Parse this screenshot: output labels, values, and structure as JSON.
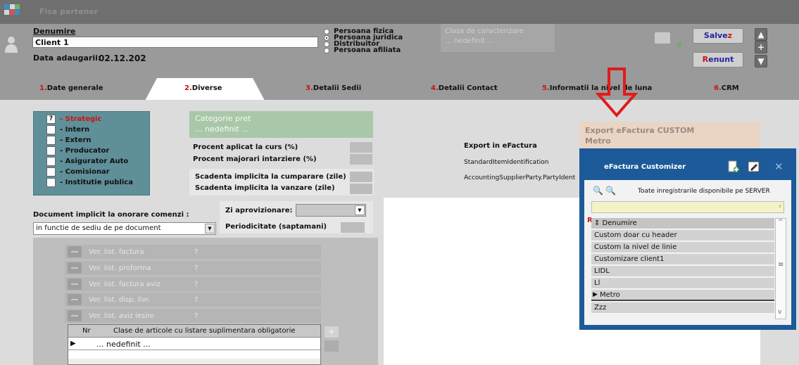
{
  "window": {
    "title": "Fisa partener",
    "icon": "app-grid-icon"
  },
  "header": {
    "denumire_label": "Denumire",
    "client_name": "Client 1",
    "data_adaugarii_label": "Data adaugarii:",
    "data_adaugarii_value": "02.12.202",
    "radio_options": [
      {
        "label": "Persoana fizica",
        "selected": false
      },
      {
        "label": "Persoana juridica",
        "selected": true
      },
      {
        "label": "Distribuitor",
        "selected": false
      },
      {
        "label": "Persoana afiliata",
        "selected": false
      }
    ],
    "clasa_label": "Clasa de caracterizare",
    "clasa_value": "... nedefinit ...",
    "folder_count": "0",
    "salvez_main": "Salve",
    "salvez_hotkey": "z",
    "renunt_hotkey": "R",
    "renunt_rest": "enunt"
  },
  "tabs": [
    {
      "num": "1.",
      "label": "Date generale"
    },
    {
      "num": "2.",
      "label": "Diverse"
    },
    {
      "num": "3.",
      "label": "Detalii Sedii"
    },
    {
      "num": "4.",
      "label": "Detalii Contact"
    },
    {
      "num": "5.",
      "label": "Informatii la nivel de luna"
    },
    {
      "num": "6.",
      "label": "CRM"
    }
  ],
  "flags": [
    {
      "label": "- Strategic",
      "value": "?",
      "highlight": true
    },
    {
      "label": "- Intern",
      "value": ""
    },
    {
      "label": "- Extern",
      "value": ""
    },
    {
      "label": "- Producator",
      "value": ""
    },
    {
      "label": "- Asigurator Auto",
      "value": ""
    },
    {
      "label": "- Comisionar",
      "value": ""
    },
    {
      "label": "- Institutie publica",
      "value": ""
    }
  ],
  "categorie_pret": {
    "label": "Categorie pret",
    "value": "... nedefinit ..."
  },
  "procent": {
    "curs": "Procent aplicat la curs (%)",
    "majorari": "Procent majorari intarziere (%)"
  },
  "scadenta": {
    "cumparare": "Scadenta implicita la cumparare (zile)",
    "vanzare": "Scadenta implicita la vanzare (zile)"
  },
  "document": {
    "label": "Document implicit la onorare comenzi :",
    "value": "in functie de sediu de pe document"
  },
  "aprovizionare": {
    "zi_label": "Zi aprovizionare:",
    "periodicitate_label": "Periodicitate (saptamani)"
  },
  "ver_list": [
    {
      "label": "Ver. list. factura",
      "value": "?"
    },
    {
      "label": "Ver. list. proforma",
      "value": "?"
    },
    {
      "label": "Ver. list. factura aviz",
      "value": "?"
    },
    {
      "label": "Ver. list. disp. livr.",
      "value": "?"
    },
    {
      "label": "Ver. list. aviz iesire",
      "value": "?"
    }
  ],
  "articole_table": {
    "col_nr": "Nr",
    "col_clase": "Clase de articole cu listare suplimentara obligatorie",
    "row_value": "... nedefinit ..."
  },
  "efactura": {
    "export_label": "Export in eFactura",
    "fields": [
      "StandardItemIdentification",
      "AccountingSupplierParty.PartyIdent"
    ],
    "custom_label": "Export eFactura CUSTOM",
    "custom_value": "Metro"
  },
  "popup": {
    "title": "eFactura Customizer",
    "filter_text": "Toate inregistrarile disponibile pe SERVER",
    "column_marker": "R",
    "column_header": "⇕ Denumire",
    "items": [
      "Custom  doar cu header",
      "Custom la nivel de linie",
      "Customizare client1",
      "LIDL",
      "Ll",
      "Metro",
      "Zzz"
    ],
    "selected_index": 5
  },
  "colors": {
    "header_gray": "#9a9a9a",
    "teal_panel": "#5f8f99",
    "green_panel": "#a9c7a9",
    "popup_blue": "#1c5a99",
    "red_accent": "#cc1414",
    "blue_label": "#23239a"
  }
}
